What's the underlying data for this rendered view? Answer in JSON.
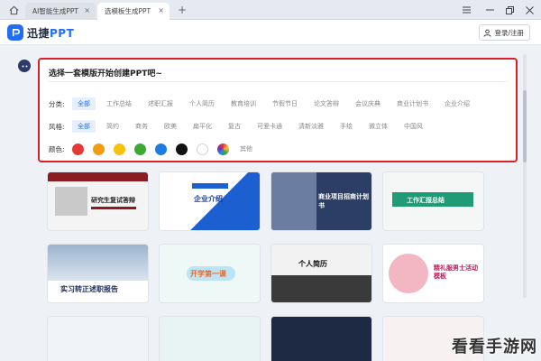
{
  "window": {
    "tabs": [
      {
        "label": "AI智能生成PPT"
      },
      {
        "label": "选模板生成PPT"
      }
    ],
    "new_tab": "+",
    "close": "×"
  },
  "app": {
    "logo_prefix": "迅捷",
    "logo_suffix": "PPT",
    "login_label": "登录/注册"
  },
  "panel": {
    "title": "选择一套模版开始创建PPT吧~",
    "category": {
      "label": "分类:",
      "options": [
        "全部",
        "工作总结",
        "述职汇报",
        "个人简历",
        "教育培训",
        "节假节日",
        "论文答辩",
        "会议庆典",
        "商业计划书",
        "企业介绍"
      ],
      "selected": "全部"
    },
    "style": {
      "label": "风格:",
      "options": [
        "全部",
        "简约",
        "商务",
        "欧美",
        "扁平化",
        "复古",
        "可爱卡通",
        "清新淡雅",
        "手绘",
        "微立体",
        "中国风"
      ],
      "selected": "全部"
    },
    "color": {
      "label": "颜色:",
      "swatches": [
        "#e53935",
        "#f39c12",
        "#f4c40f",
        "#3aaa35",
        "#1e7be0",
        "#111111",
        "#ffffff",
        "multicolor"
      ],
      "other_label": "其他"
    }
  },
  "templates": {
    "row1": [
      {
        "title": "研究生复试答辩"
      },
      {
        "title": "企业介绍"
      },
      {
        "title": "商业项目招商计划书"
      },
      {
        "title": "工作汇报总结"
      }
    ],
    "row2": [
      {
        "title": "实习转正述职报告"
      },
      {
        "title": "开学第一课"
      },
      {
        "title": "个人简历"
      },
      {
        "title": "精礼服男士活动模板"
      }
    ]
  },
  "watermark": "看看手游网",
  "colors": {
    "accent": "#1f6ef5",
    "highlight_border": "#d9202b"
  }
}
